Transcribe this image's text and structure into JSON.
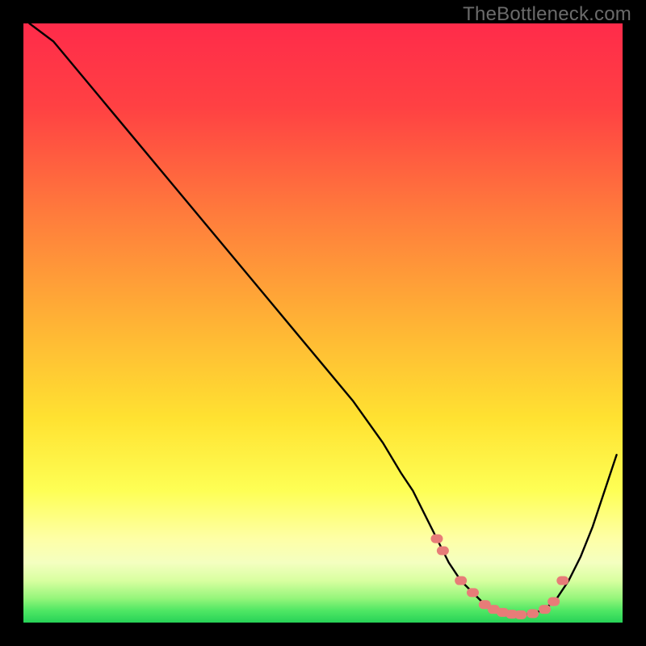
{
  "watermark": "TheBottleneck.com",
  "colors": {
    "black": "#000000",
    "red_top": "#ff2b4a",
    "orange": "#ff8a3a",
    "yellow": "#ffe231",
    "pale_yellow": "#feff9a",
    "green_light": "#c8ff7a",
    "green": "#2cde5a",
    "curve": "#000000",
    "marker": "#e77c78",
    "watermark": "#6b6b6b"
  },
  "chart_data": {
    "type": "line",
    "title": "",
    "xlabel": "",
    "ylabel": "",
    "xlim": [
      0,
      100
    ],
    "ylim": [
      0,
      100
    ],
    "gradient_stops": [
      {
        "offset": 0,
        "color": "#ff2b4a"
      },
      {
        "offset": 14,
        "color": "#ff4143"
      },
      {
        "offset": 32,
        "color": "#ff7c3c"
      },
      {
        "offset": 50,
        "color": "#ffb335"
      },
      {
        "offset": 66,
        "color": "#ffe231"
      },
      {
        "offset": 78,
        "color": "#feff55"
      },
      {
        "offset": 86,
        "color": "#feffa6"
      },
      {
        "offset": 90,
        "color": "#f4ffc0"
      },
      {
        "offset": 93,
        "color": "#d8ffa0"
      },
      {
        "offset": 96,
        "color": "#94f57a"
      },
      {
        "offset": 98,
        "color": "#4fe764"
      },
      {
        "offset": 100,
        "color": "#27d257"
      }
    ],
    "series": [
      {
        "name": "bottleneck-curve",
        "x": [
          1,
          5,
          10,
          15,
          20,
          25,
          30,
          35,
          40,
          45,
          50,
          55,
          60,
          63,
          65,
          67,
          69,
          71,
          73,
          75,
          77,
          79,
          81,
          83,
          85,
          87,
          89,
          91,
          93,
          95,
          97,
          99
        ],
        "y": [
          100,
          97,
          91,
          85,
          79,
          73,
          67,
          61,
          55,
          49,
          43,
          37,
          30,
          25,
          22,
          18,
          14,
          10,
          7,
          5,
          3,
          2,
          1.5,
          1.3,
          1.5,
          2.2,
          4,
          7,
          11,
          16,
          22,
          28
        ]
      }
    ],
    "markers": {
      "name": "highlighted-segment",
      "x": [
        69,
        70,
        73,
        75,
        77,
        78.5,
        80,
        81.5,
        83,
        85,
        87,
        88.5,
        90
      ],
      "y": [
        14,
        12,
        7,
        5,
        3,
        2.2,
        1.7,
        1.4,
        1.3,
        1.5,
        2.2,
        3.5,
        7
      ]
    }
  }
}
